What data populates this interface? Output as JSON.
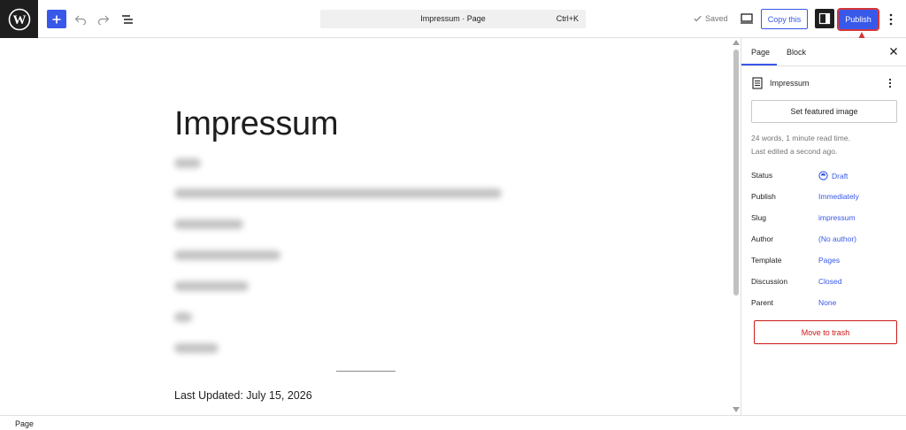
{
  "toolbar": {
    "command_bar": {
      "title": "Impressum · Page",
      "shortcut": "Ctrl+K"
    },
    "saved_label": "Saved",
    "copy_label": "Copy this",
    "publish_label": "Publish",
    "icons": [
      "wordpress-logo-icon",
      "plus-icon",
      "undo-icon",
      "redo-icon",
      "document-overview-icon",
      "check-icon",
      "desktop-preview-icon",
      "sidebar-toggle-icon",
      "more-vertical-icon"
    ]
  },
  "annotation": {
    "color": "#d63638"
  },
  "editor": {
    "title": "Impressum",
    "redacted_line_count": 7,
    "last_updated": "Last Updated: July 15, 2026"
  },
  "sidebar": {
    "tabs": [
      {
        "label": "Page",
        "active": true
      },
      {
        "label": "Block",
        "active": false
      }
    ],
    "doc_title": "Impressum",
    "featured_image_label": "Set featured image",
    "meta_words": "24 words, 1 minute read time.",
    "meta_edited": "Last edited a second ago.",
    "properties": [
      {
        "label": "Status",
        "value": "Draft"
      },
      {
        "label": "Publish",
        "value": "Immediately"
      },
      {
        "label": "Slug",
        "value": "impressum"
      },
      {
        "label": "Author",
        "value": "(No author)"
      },
      {
        "label": "Template",
        "value": "Pages"
      },
      {
        "label": "Discussion",
        "value": "Closed"
      },
      {
        "label": "Parent",
        "value": "None"
      }
    ],
    "trash_label": "Move to trash"
  },
  "footer": {
    "breadcrumb": "Page"
  },
  "colors": {
    "accent": "#3858e9",
    "danger": "#cc1818",
    "dark": "#1e1e1e"
  }
}
